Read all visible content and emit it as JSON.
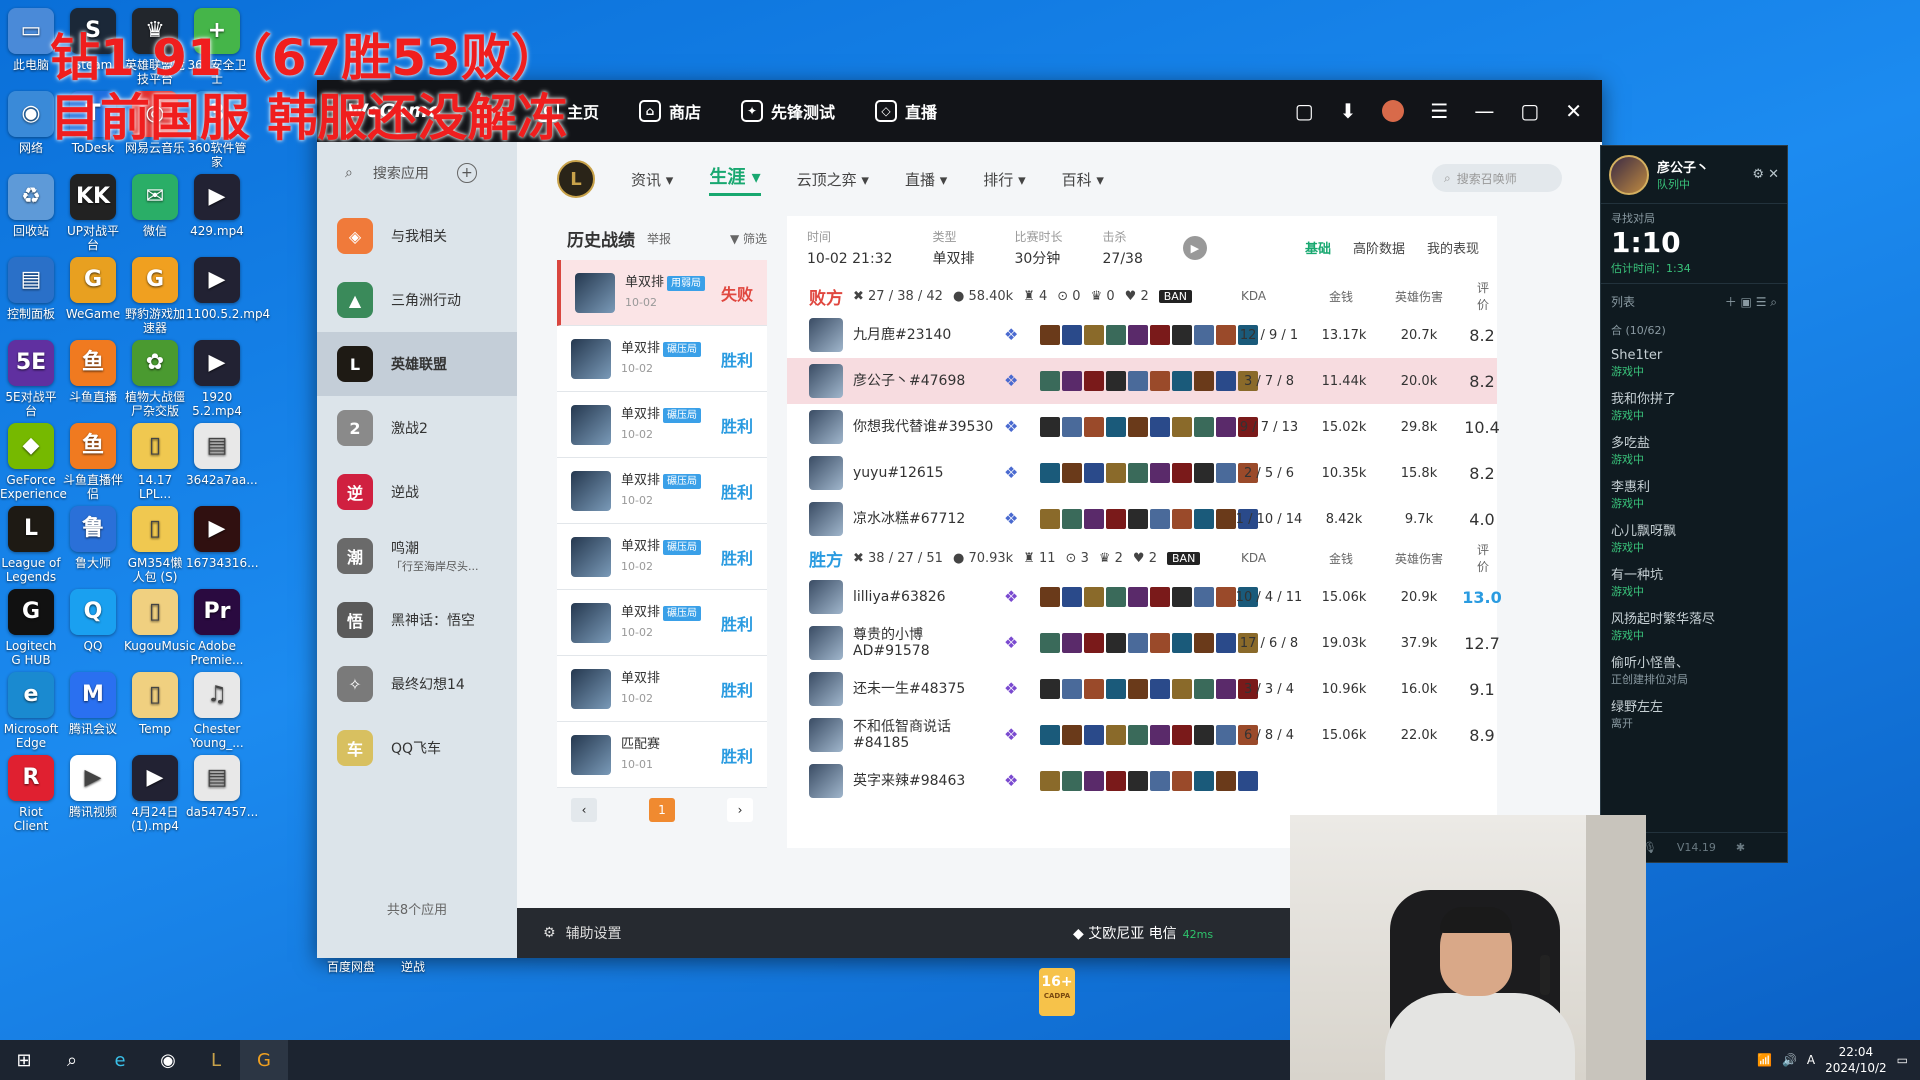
{
  "overlay": {
    "line1": "钻1 91（67胜53败）",
    "line2": "目前国服 韩服还没解冻"
  },
  "desktop": [
    {
      "label": "此电脑",
      "color": "#4a8ad8",
      "g": "▭"
    },
    {
      "label": "Steam",
      "color": "#1b2838",
      "g": "S"
    },
    {
      "label": "英雄联盟竞技平台",
      "color": "#22262c",
      "g": "♛"
    },
    {
      "label": "360安全卫士",
      "color": "#45b549",
      "g": "+"
    },
    {
      "label": "网络",
      "color": "#3a8ad8",
      "g": "◉"
    },
    {
      "label": "ToDesk",
      "color": "#1e6fe0",
      "g": "T"
    },
    {
      "label": "网易云音乐",
      "color": "#e03030",
      "g": "◎"
    },
    {
      "label": "360软件管家",
      "color": "#2a8ae0",
      "g": "3"
    },
    {
      "label": "回收站",
      "color": "#5e9ad8",
      "g": "♻"
    },
    {
      "label": "UP对战平台",
      "color": "#222",
      "g": "KK"
    },
    {
      "label": "微信",
      "color": "#2aae67",
      "g": "✉"
    },
    {
      "label": "429.mp4",
      "color": "#223",
      "g": "▶"
    },
    {
      "label": "控制面板",
      "color": "#2a70c8",
      "g": "▤"
    },
    {
      "label": "WeGame",
      "color": "#e8a020",
      "g": "G"
    },
    {
      "label": "野豹游戏加速器",
      "color": "#f0a020",
      "g": "G"
    },
    {
      "label": "1100.5.2.mp4",
      "color": "#223",
      "g": "▶"
    },
    {
      "label": "5E对战平台",
      "color": "#6030a0",
      "g": "5E"
    },
    {
      "label": "斗鱼直播",
      "color": "#f07a20",
      "g": "鱼"
    },
    {
      "label": "植物大战僵尸杂交版",
      "color": "#4a9a30",
      "g": "✿"
    },
    {
      "label": "1920 5.2.mp4",
      "color": "#223",
      "g": "▶"
    },
    {
      "label": "GeForce Experience",
      "color": "#76b900",
      "g": "◆"
    },
    {
      "label": "斗鱼直播伴侣",
      "color": "#f07a20",
      "g": "鱼"
    },
    {
      "label": "14.17 LPL...",
      "color": "#f0c850",
      "g": "▯"
    },
    {
      "label": "3642a7aa...",
      "color": "#e8e8e8",
      "g": "▤"
    },
    {
      "label": "League of Legends",
      "color": "#1e1a14",
      "g": "L"
    },
    {
      "label": "鲁大师",
      "color": "#2a70d8",
      "g": "鲁"
    },
    {
      "label": "GM354懒人包 (S)",
      "color": "#f0c850",
      "g": "▯"
    },
    {
      "label": "16734316...",
      "color": "#301010",
      "g": "▶"
    },
    {
      "label": "Logitech G HUB",
      "color": "#111",
      "g": "G"
    },
    {
      "label": "QQ",
      "color": "#1aa0f0",
      "g": "Q"
    },
    {
      "label": "KugouMusic",
      "color": "#f0d080",
      "g": "▯"
    },
    {
      "label": "Adobe Premie...",
      "color": "#2a0a40",
      "g": "Pr"
    },
    {
      "label": "Microsoft Edge",
      "color": "#1a8ad0",
      "g": "e"
    },
    {
      "label": "腾讯会议",
      "color": "#2a70f0",
      "g": "M"
    },
    {
      "label": "Temp",
      "color": "#f0d080",
      "g": "▯"
    },
    {
      "label": "Chester Young_...",
      "color": "#e8e8e8",
      "g": "♫"
    },
    {
      "label": "Riot Client",
      "color": "#e02030",
      "g": "R"
    },
    {
      "label": "腾讯视频",
      "color": "#fff",
      "g": "▶"
    },
    {
      "label": "4月24日(1).mp4",
      "color": "#223",
      "g": "▶"
    },
    {
      "label": "da547457...",
      "color": "#e8e8e8",
      "g": "▤"
    }
  ],
  "desk_extra": [
    {
      "label": "百度网盘"
    },
    {
      "label": "逆战"
    }
  ],
  "window": {
    "brand": "WeGame",
    "nav": [
      {
        "icon": "G",
        "label": "主页"
      },
      {
        "icon": "⌂",
        "label": "商店"
      },
      {
        "icon": "✦",
        "label": "先锋测试"
      },
      {
        "icon": "◇",
        "label": "直播"
      }
    ],
    "search_apps": "搜索应用",
    "apps": [
      {
        "name": "与我相关",
        "color": "#f07a3a",
        "g": "◈"
      },
      {
        "name": "三角洲行动",
        "color": "#3a8a5a",
        "g": "▲"
      },
      {
        "name": "英雄联盟",
        "color": "#1e1a14",
        "g": "L",
        "active": true
      },
      {
        "name": "激战2",
        "color": "#8a8a8a",
        "g": "2"
      },
      {
        "name": "逆战",
        "color": "#d02040",
        "g": "逆"
      },
      {
        "name": "鸣潮",
        "color": "#6a6a6a",
        "g": "潮",
        "sub": "「行至海岸尽头..."
      },
      {
        "name": "黑神话：悟空",
        "color": "#5a5a5a",
        "g": "悟"
      },
      {
        "name": "最终幻想14",
        "color": "#7a7a7a",
        "g": "✧"
      },
      {
        "name": "QQ飞车",
        "color": "#d8c060",
        "g": "车"
      }
    ],
    "apps_count": "共8个应用",
    "subnav": [
      "资讯",
      "生涯",
      "云顶之弈",
      "直播",
      "排行",
      "百科"
    ],
    "subnav_active": 1,
    "summoner_search": "搜索召唤师",
    "history_title": "历史战绩",
    "history_report": "举报",
    "history_filter": "筛选",
    "games": [
      {
        "mode": "单双排",
        "tag": "用弱局",
        "date": "10-02",
        "result": "失败",
        "win": false,
        "sel": true
      },
      {
        "mode": "单双排",
        "tag": "碾压局",
        "date": "10-02",
        "result": "胜利",
        "win": true
      },
      {
        "mode": "单双排",
        "tag": "碾压局",
        "date": "10-02",
        "result": "胜利",
        "win": true
      },
      {
        "mode": "单双排",
        "tag": "碾压局",
        "date": "10-02",
        "result": "胜利",
        "win": true
      },
      {
        "mode": "单双排",
        "tag": "碾压局",
        "date": "10-02",
        "result": "胜利",
        "win": true
      },
      {
        "mode": "单双排",
        "tag": "碾压局",
        "date": "10-02",
        "result": "胜利",
        "win": true
      },
      {
        "mode": "单双排",
        "tag": "",
        "date": "10-02",
        "result": "胜利",
        "win": true
      },
      {
        "mode": "匹配赛",
        "tag": "",
        "date": "10-01",
        "result": "胜利",
        "win": true
      }
    ],
    "page": "1",
    "detail": {
      "time_l": "时间",
      "time": "10-02 21:32",
      "type_l": "类型",
      "type": "单双排",
      "dur_l": "比赛时长",
      "dur": "30分钟",
      "kill_l": "击杀",
      "kill": "27/38",
      "tabs": [
        "基础",
        "高阶数据",
        "我的表现"
      ],
      "lose": {
        "name": "败方",
        "kda": "27 / 38 / 42",
        "gold": "58.40k",
        "t": "4",
        "d": "0",
        "b": "0",
        "h": "2"
      },
      "win": {
        "name": "胜方",
        "kda": "38 / 27 / 51",
        "gold": "70.93k",
        "t": "11",
        "d": "3",
        "b": "2",
        "h": "2"
      },
      "ban": "BAN",
      "cols": {
        "kda": "KDA",
        "gold": "金钱",
        "dmg": "英雄伤害",
        "score": "评价"
      },
      "lose_players": [
        {
          "name": "九月鹿#23140",
          "sub": "",
          "kda": "12 / 9 / 1",
          "gold": "13.17k",
          "dmg": "20.7k",
          "score": "8.2"
        },
        {
          "name": "彦公子丶#47698",
          "sub": "",
          "kda": "3 / 7 / 8",
          "gold": "11.44k",
          "dmg": "20.0k",
          "score": "8.2",
          "me": true
        },
        {
          "name": "你想我代替谁#39530",
          "sub": "",
          "kda": "9 / 7 / 13",
          "gold": "15.02k",
          "dmg": "29.8k",
          "score": "10.4"
        },
        {
          "name": "yuyu#12615",
          "sub": "",
          "kda": "2 / 5 / 6",
          "gold": "10.35k",
          "dmg": "15.8k",
          "score": "8.2"
        },
        {
          "name": "凉水冰糕#67712",
          "sub": "",
          "kda": "1 / 10 / 14",
          "gold": "8.42k",
          "dmg": "9.7k",
          "score": "4.0"
        }
      ],
      "win_players": [
        {
          "name": "lilliya#63826",
          "sub": "",
          "kda": "10 / 4 / 11",
          "gold": "15.06k",
          "dmg": "20.9k",
          "score": "13.0",
          "hi": true
        },
        {
          "name": "尊贵的小博AD#91578",
          "sub": "",
          "kda": "17 / 6 / 8",
          "gold": "19.03k",
          "dmg": "37.9k",
          "score": "12.7"
        },
        {
          "name": "还未一生#48375",
          "sub": "",
          "kda": "3 / 3 / 4",
          "gold": "10.96k",
          "dmg": "16.0k",
          "score": "9.1"
        },
        {
          "name": "不和低智商说话#84185",
          "sub": "",
          "kda": "6 / 8 / 4",
          "gold": "15.06k",
          "dmg": "22.0k",
          "score": "8.9"
        },
        {
          "name": "英字来辣#98463",
          "sub": "",
          "kda": "",
          "gold": "",
          "dmg": "",
          "score": ""
        }
      ]
    },
    "assist": "辅助设置",
    "server": "艾欧尼亚 电信",
    "ping": "42ms",
    "age": "16+"
  },
  "chat": {
    "user": "彦公子丶",
    "status": "队列中",
    "queue_title": "寻找对局",
    "queue_time": "1:10",
    "queue_est": "估计时间：1:34",
    "list_title": "列表",
    "group": "合 (10/62)",
    "friends": [
      {
        "n": "She1ter",
        "s": "游戏中"
      },
      {
        "n": "我和你拼了",
        "s": "游戏中"
      },
      {
        "n": "多吃盐",
        "s": "游戏中"
      },
      {
        "n": "李惠利",
        "s": "游戏中"
      },
      {
        "n": "心儿飘呀飘",
        "s": "游戏中"
      },
      {
        "n": "有一种坑",
        "s": "游戏中"
      },
      {
        "n": "风扬起时繁华落尽",
        "s": "游戏中"
      },
      {
        "n": "偷听小怪兽、",
        "s": "正创建排位对局",
        "off": true
      },
      {
        "n": "绿野左左",
        "s": "离开",
        "off": true
      }
    ],
    "version": "V14.19"
  },
  "taskbar": {
    "time": "22:04",
    "date": "2024/10/2"
  }
}
